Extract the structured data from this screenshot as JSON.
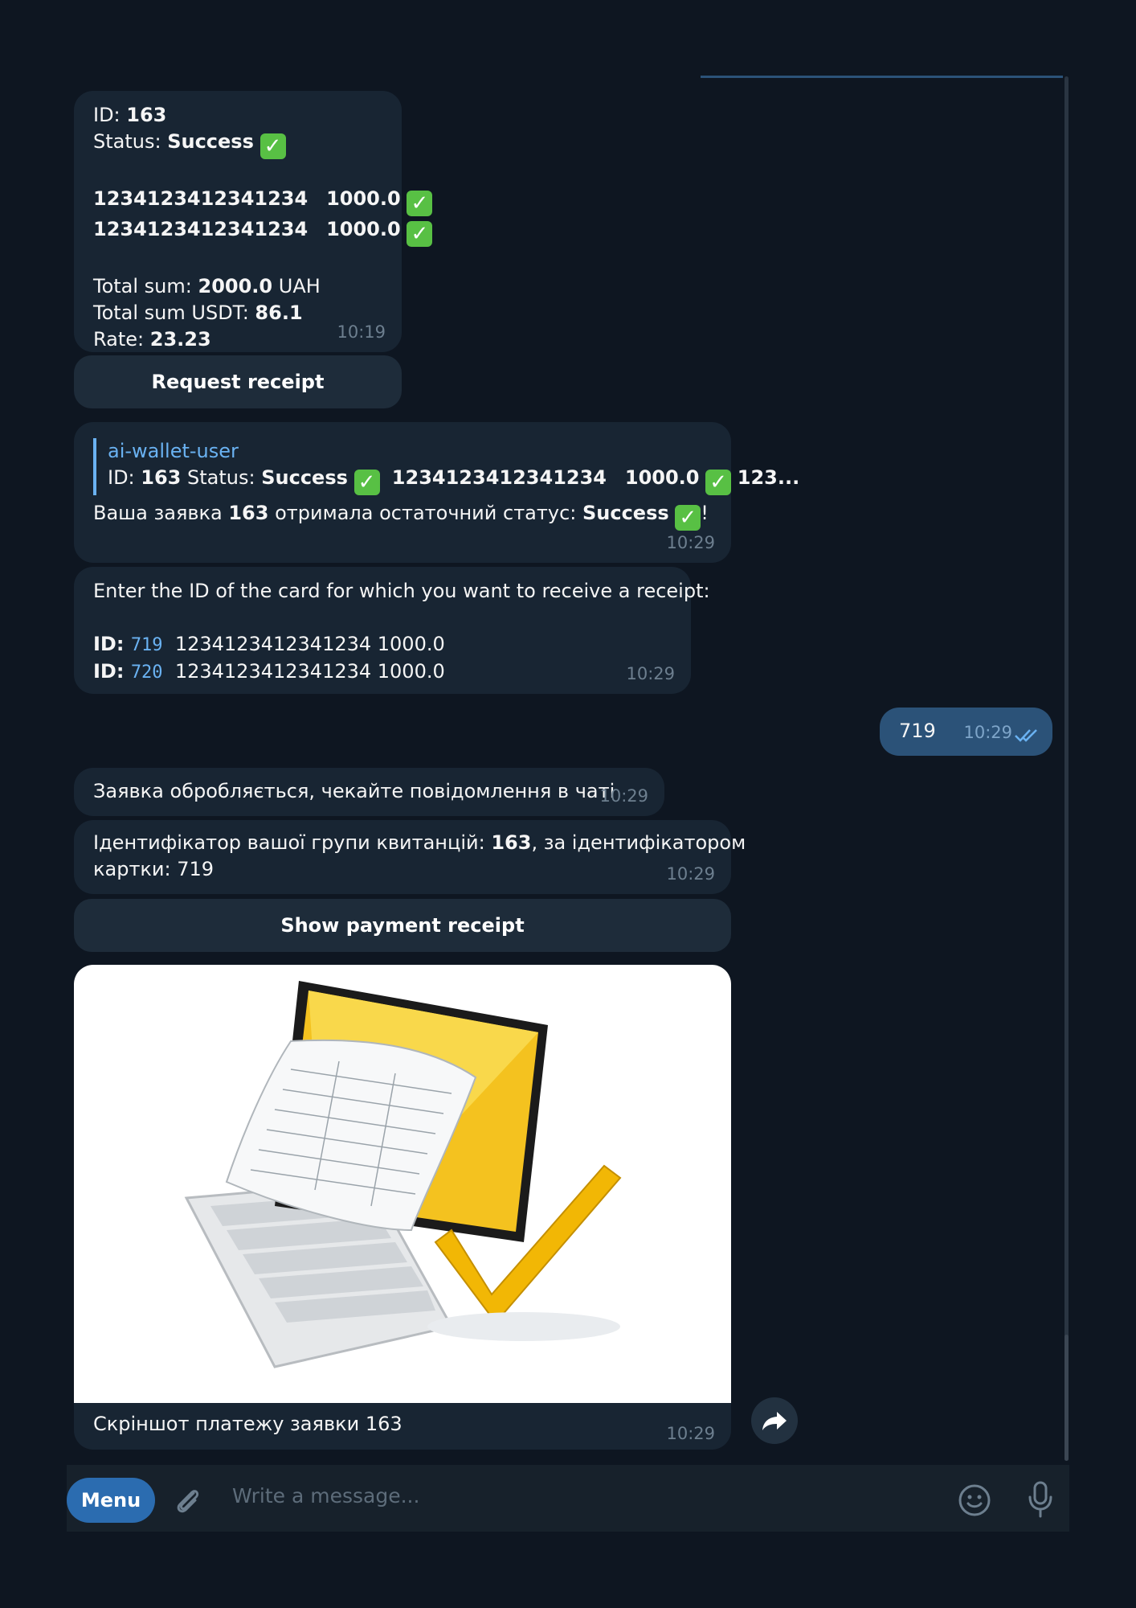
{
  "message1": {
    "id_label": "ID: ",
    "id_value": "163",
    "status_label": "Status: ",
    "status_value": "Success",
    "cards": [
      {
        "number": "1234123412341234",
        "amount": "1000.0"
      },
      {
        "number": "1234123412341234",
        "amount": "1000.0"
      }
    ],
    "total_label": "Total sum: ",
    "total_value": "2000.0",
    "total_currency": " UAH",
    "usdt_label": "Total sum USDT: ",
    "usdt_value": "86.1",
    "rate_label": "Rate: ",
    "rate_value": "23.23",
    "time": "10:19",
    "button": "Request receipt"
  },
  "message2": {
    "quote_name": "ai-wallet-user",
    "quote_id_label": "ID: ",
    "quote_id": "163",
    "quote_status_label": " Status: ",
    "quote_status": "Success",
    "quote_card": "1234123412341234",
    "quote_amount": "1000.0",
    "quote_tail": "123...",
    "text_prefix": "Ваша заявка ",
    "text_id": "163",
    "text_middle": " отримала остаточний статус: ",
    "text_status": "Success",
    "text_end": "!",
    "time": "10:29"
  },
  "message3": {
    "text": "Enter the ID of the card for which you want to receive a receipt:",
    "rows": [
      {
        "label": "ID: ",
        "id": "719",
        "card": "1234123412341234 1000.0"
      },
      {
        "label": "ID: ",
        "id": "720",
        "card": "1234123412341234 1000.0"
      }
    ],
    "time": "10:29"
  },
  "outgoing": {
    "text": "719",
    "time": "10:29"
  },
  "message4": {
    "text": "Заявка обробляється, чекайте повідомлення в чаті",
    "time": "10:29"
  },
  "message5": {
    "line1_prefix": "Ідентифікатор вашої групи квитанцій: ",
    "line1_id": "163",
    "line1_suffix": ", за ідентифікатором",
    "line2": "картки: 719",
    "time": "10:29",
    "button": "Show payment receipt"
  },
  "photo_message": {
    "caption": "Скріншот платежу заявки 163",
    "time": "10:29"
  },
  "input": {
    "menu": "Menu",
    "placeholder": "Write a message..."
  },
  "colors": {
    "background": "#0e1621",
    "bubble_in": "#182533",
    "bubble_out": "#2b5278",
    "accent": "#6ab2f2",
    "check": "#58c044"
  }
}
